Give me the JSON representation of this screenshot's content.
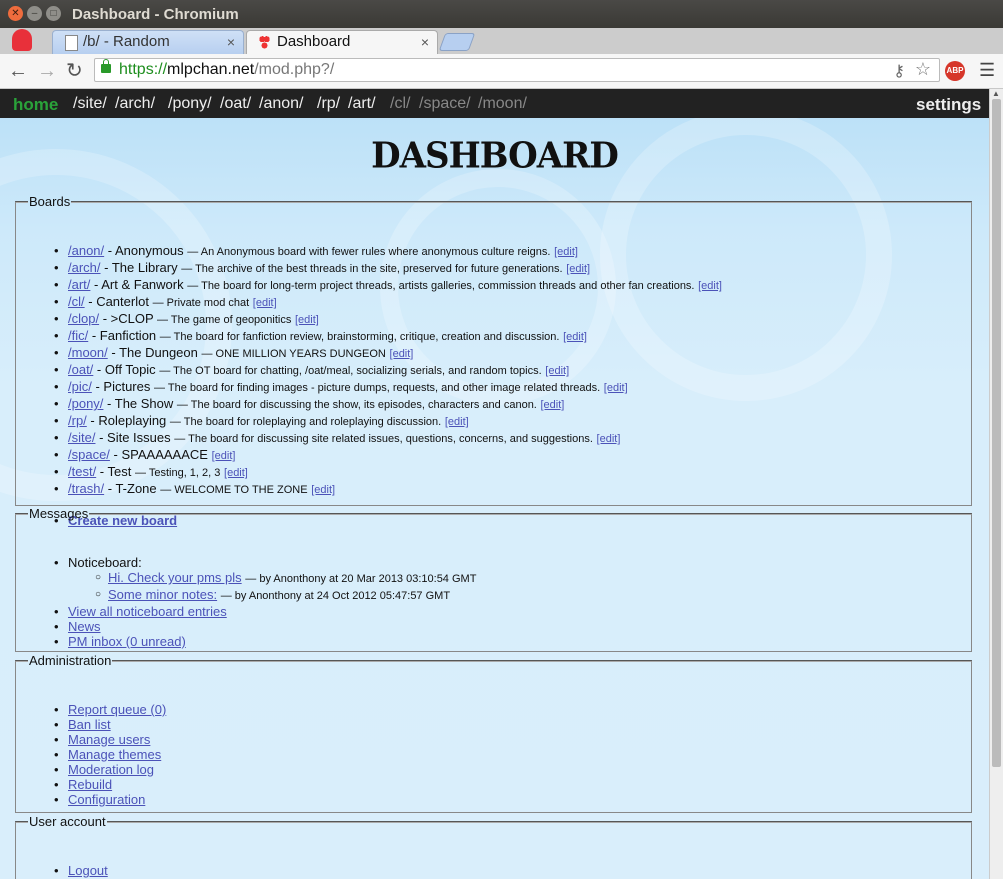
{
  "window": {
    "title": "Dashboard - Chromium"
  },
  "tabs": [
    {
      "label": "/b/ - Random",
      "close": "×"
    },
    {
      "label": "Dashboard",
      "close": "×"
    }
  ],
  "address": {
    "scheme": "https://",
    "host": "mlpchan.net",
    "path": "/mod.php?/",
    "abp": "ABP"
  },
  "boardnav": {
    "home": "home",
    "boards": [
      "/site/",
      "/arch/",
      "/pony/",
      "/oat/",
      "/anon/",
      "/rp/",
      "/art/"
    ],
    "dim_boards": [
      "/cl/",
      "/space/",
      "/moon/"
    ],
    "settings": "settings"
  },
  "page": {
    "logo": "DASHBOARD"
  },
  "boards_section": {
    "legend": "Boards",
    "items": [
      {
        "uri": "/anon/",
        "name": "Anonymous",
        "desc": "An Anonymous board with fewer rules where anonymous culture reigns."
      },
      {
        "uri": "/arch/",
        "name": "The Library",
        "desc": "The archive of the best threads in the site, preserved for future generations."
      },
      {
        "uri": "/art/",
        "name": "Art & Fanwork",
        "desc": "The board for long-term project threads, artists galleries, commission threads and other fan creations."
      },
      {
        "uri": "/cl/",
        "name": "Canterlot",
        "desc": "Private mod chat"
      },
      {
        "uri": "/clop/",
        "name": ">CLOP",
        "desc": "The game of geoponitics"
      },
      {
        "uri": "/fic/",
        "name": "Fanfiction",
        "desc": "The board for fanfiction review, brainstorming, critique, creation and discussion."
      },
      {
        "uri": "/moon/",
        "name": "The Dungeon",
        "desc": "ONE MILLION YEARS DUNGEON"
      },
      {
        "uri": "/oat/",
        "name": "Off Topic",
        "desc": "The OT board for chatting, /oat/meal, socializing serials, and random topics."
      },
      {
        "uri": "/pic/",
        "name": "Pictures",
        "desc": "The board for finding images - picture dumps, requests, and other image related threads."
      },
      {
        "uri": "/pony/",
        "name": "The Show",
        "desc": "The board for discussing the show, its episodes, characters and canon."
      },
      {
        "uri": "/rp/",
        "name": "Roleplaying",
        "desc": "The board for roleplaying and roleplaying discussion."
      },
      {
        "uri": "/site/",
        "name": "Site Issues",
        "desc": "The board for discussing site related issues, questions, concerns, and suggestions."
      },
      {
        "uri": "/space/",
        "name": "SPAAAAAACE",
        "desc": ""
      },
      {
        "uri": "/test/",
        "name": "Test",
        "desc": "Testing, 1, 2, 3"
      },
      {
        "uri": "/trash/",
        "name": "T-Zone",
        "desc": "WELCOME TO THE ZONE"
      }
    ],
    "edit_label": "[edit]",
    "create_label": "Create new board"
  },
  "messages_section": {
    "legend": "Messages",
    "noticeboard_label": "Noticeboard:",
    "notices": [
      {
        "title": "Hi. Check your pms pls",
        "meta": "— by Anonthony at 20 Mar 2013 03:10:54 GMT"
      },
      {
        "title": "Some minor notes:",
        "meta": "— by Anonthony at 24 Oct 2012 05:47:57 GMT"
      }
    ],
    "links": [
      "View all noticeboard entries",
      "News",
      "PM inbox (0 unread)"
    ]
  },
  "admin_section": {
    "legend": "Administration",
    "links": [
      "Report queue (0)",
      "Ban list",
      "Manage users",
      "Manage themes",
      "Moderation log",
      "Rebuild",
      "Configuration"
    ]
  },
  "user_section": {
    "legend": "User account",
    "links": [
      "Logout"
    ]
  },
  "colors": {
    "link": "#4b52b8",
    "home": "#2aa33a",
    "navbar": "#222222",
    "background": "#d9eefb"
  }
}
